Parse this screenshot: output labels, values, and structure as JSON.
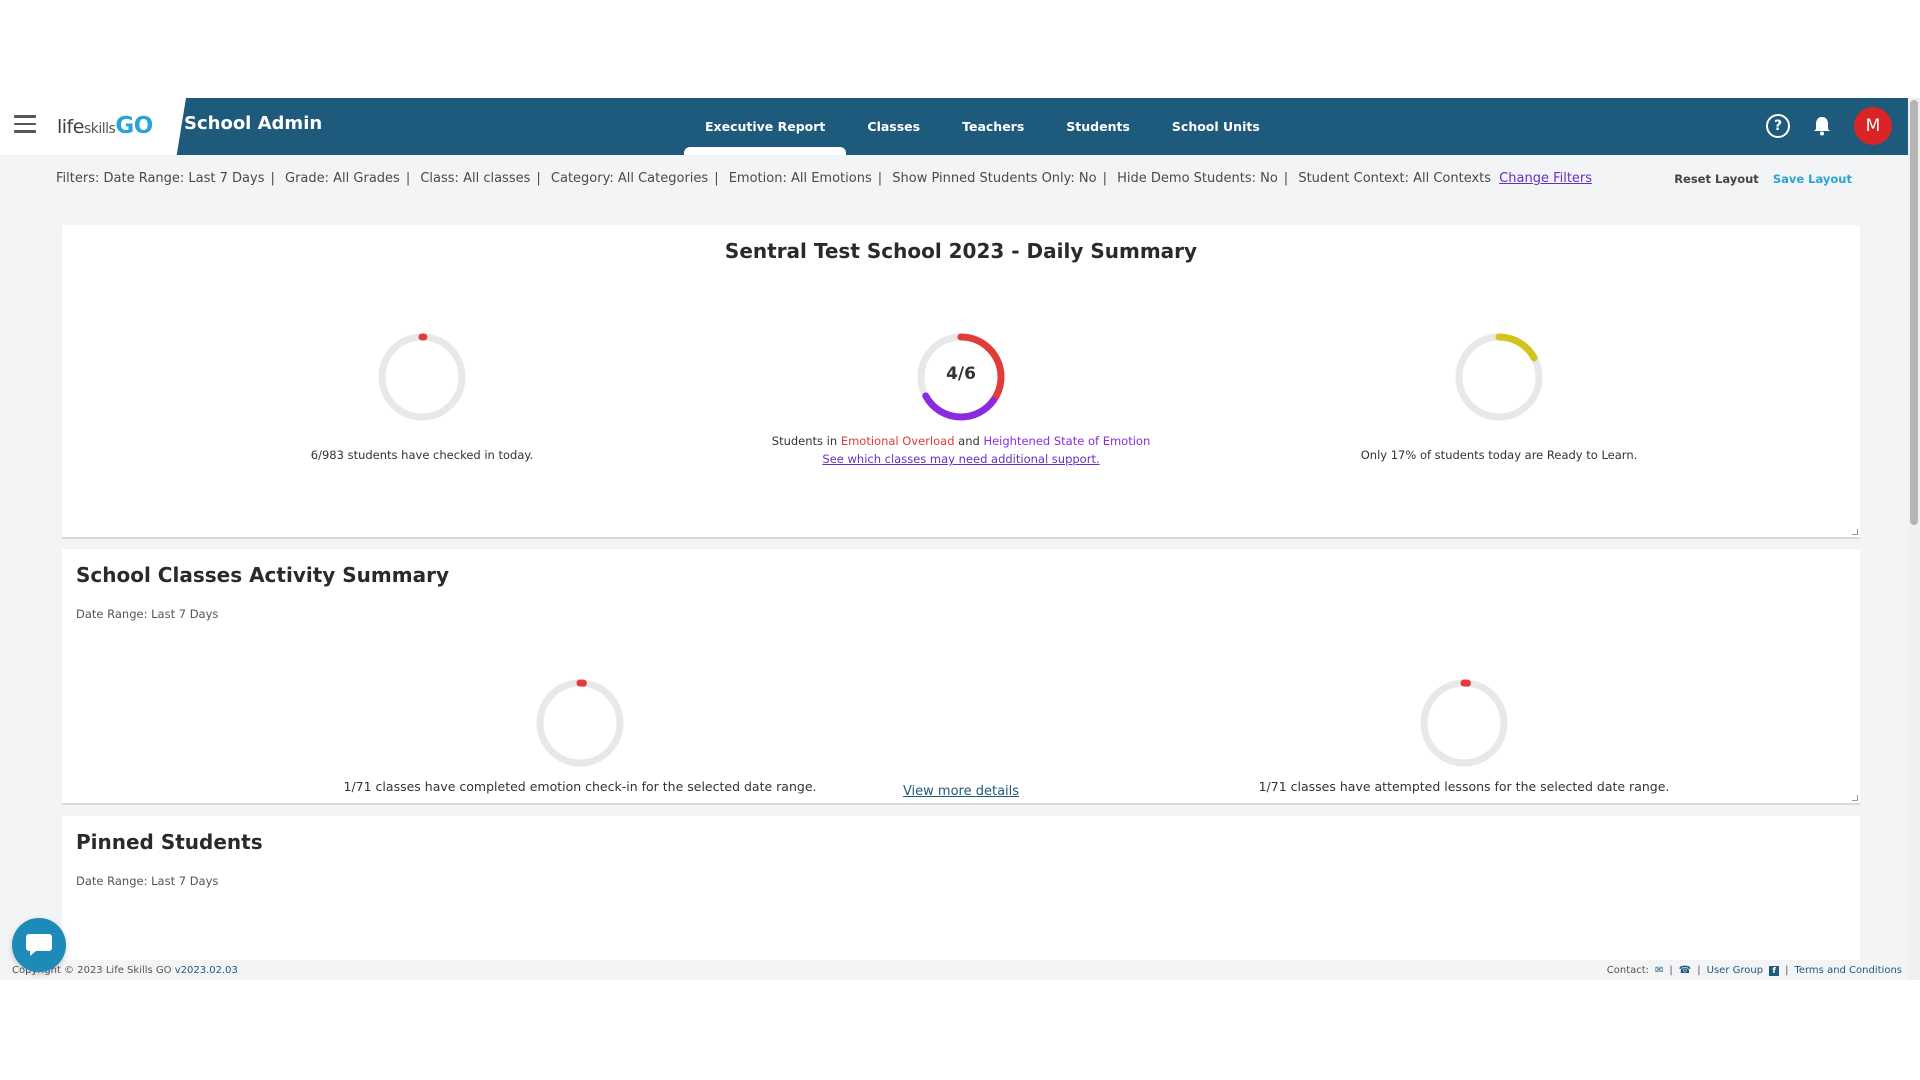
{
  "header": {
    "logo_life": "life",
    "logo_skills": "skills",
    "logo_go": "GO",
    "app_title": "School Admin",
    "tabs": [
      {
        "label": "Executive Report",
        "active": true
      },
      {
        "label": "Classes"
      },
      {
        "label": "Teachers"
      },
      {
        "label": "Students"
      },
      {
        "label": "School Units"
      }
    ],
    "avatar_initial": "M",
    "help_label": "?",
    "icons": [
      "menu-icon",
      "help-icon",
      "bell-icon"
    ]
  },
  "filters": {
    "prefix": "Filters:",
    "items": [
      "Date Range: Last 7 Days",
      "Grade: All Grades",
      "Class: All classes",
      "Category: All Categories",
      "Emotion: All Emotions",
      "Show Pinned Students Only: No",
      "Hide Demo Students: No",
      "Student Context: All Contexts"
    ],
    "change_link": "Change Filters",
    "reset_layout": "Reset Layout",
    "save_layout": "Save Layout"
  },
  "daily_summary": {
    "title": "Sentral Test School 2023 - Daily Summary",
    "checkin": {
      "text": "6/983 students have checked in today.",
      "fraction": 0.0061
    },
    "emotion": {
      "ring_label": "4/6",
      "fraction_red": 0.35,
      "fraction_purple": 0.32,
      "line_prefix": "Students in",
      "overload": "Emotional Overload",
      "and": "and",
      "heightened": "Heightened State of Emotion",
      "support_link": "See which classes may need additional support."
    },
    "ready": {
      "text": "Only 17% of students today are Ready to Learn.",
      "fraction": 0.17
    }
  },
  "classes_summary": {
    "title": "School Classes Activity Summary",
    "date_range": "Date Range: Last 7 Days",
    "emotion_checkin": {
      "text": "1/71 classes have completed emotion check-in for the selected date range.",
      "fraction": 0.014
    },
    "lessons": {
      "text": "1/71 classes have attempted lessons for the selected date range.",
      "fraction": 0.014
    },
    "view_more": "View more details"
  },
  "pinned_students": {
    "title": "Pinned Students",
    "date_range": "Date Range: Last 7 Days"
  },
  "footer": {
    "copyright": "Copyright © 2023 Life Skills GO",
    "version": "v2023.02.03",
    "contact": "Contact:",
    "user_group": "User Group",
    "terms": "Terms and Conditions"
  },
  "colors": {
    "header": "#1e5a7c",
    "ring_track": "#e8e8e8",
    "red": "#e33a3a",
    "purple": "#8a2be2",
    "yellow": "#d4c21f",
    "accent": "#2ba3d8"
  }
}
